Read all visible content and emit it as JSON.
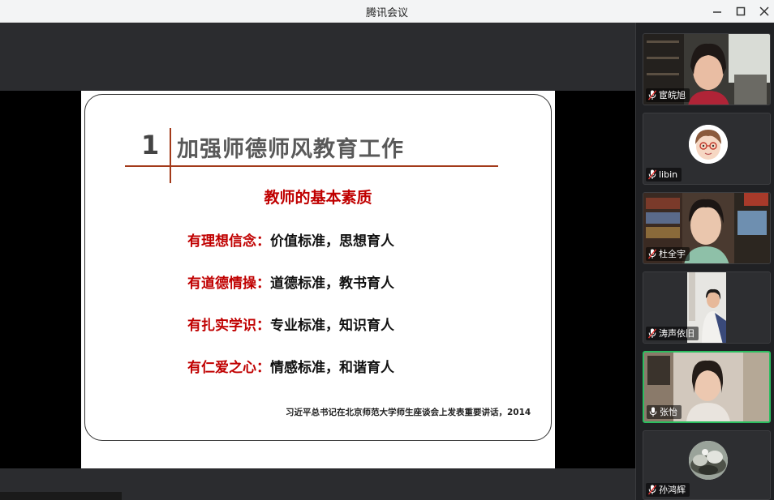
{
  "window": {
    "title": "腾讯会议",
    "minimize_icon": "minimize-icon",
    "maximize_icon": "maximize-icon",
    "close_icon": "close-icon"
  },
  "slide": {
    "number": "1",
    "heading": "加强师德师风教育工作",
    "subheading": "教师的基本素质",
    "qualities": [
      {
        "key": "有理想信念：",
        "value": "价值标准，思想育人"
      },
      {
        "key": "有道德情操：",
        "value": "道德标准，教书育人"
      },
      {
        "key": "有扎实学识：",
        "value": "专业标准，知识育人"
      },
      {
        "key": "有仁爱之心：",
        "value": "情感标准，和谐育人"
      }
    ],
    "citation": "习近平总书记在北京师范大学师生座谈会上发表重要讲话，2014"
  },
  "participants": [
    {
      "name": "宦皖旭",
      "mic": "mic-muted-icon"
    },
    {
      "name": "libin",
      "mic": "mic-muted-icon"
    },
    {
      "name": "杜全宇",
      "mic": "mic-muted-icon"
    },
    {
      "name": "涛声依旧",
      "mic": "mic-muted-icon"
    },
    {
      "name": "张怡",
      "mic": "mic-icon"
    },
    {
      "name": "孙鸿辉",
      "mic": "mic-muted-icon"
    }
  ],
  "colors": {
    "accent_red": "#c00000",
    "divider": "#a33a1a",
    "active_speaker": "#2bbd5f"
  }
}
